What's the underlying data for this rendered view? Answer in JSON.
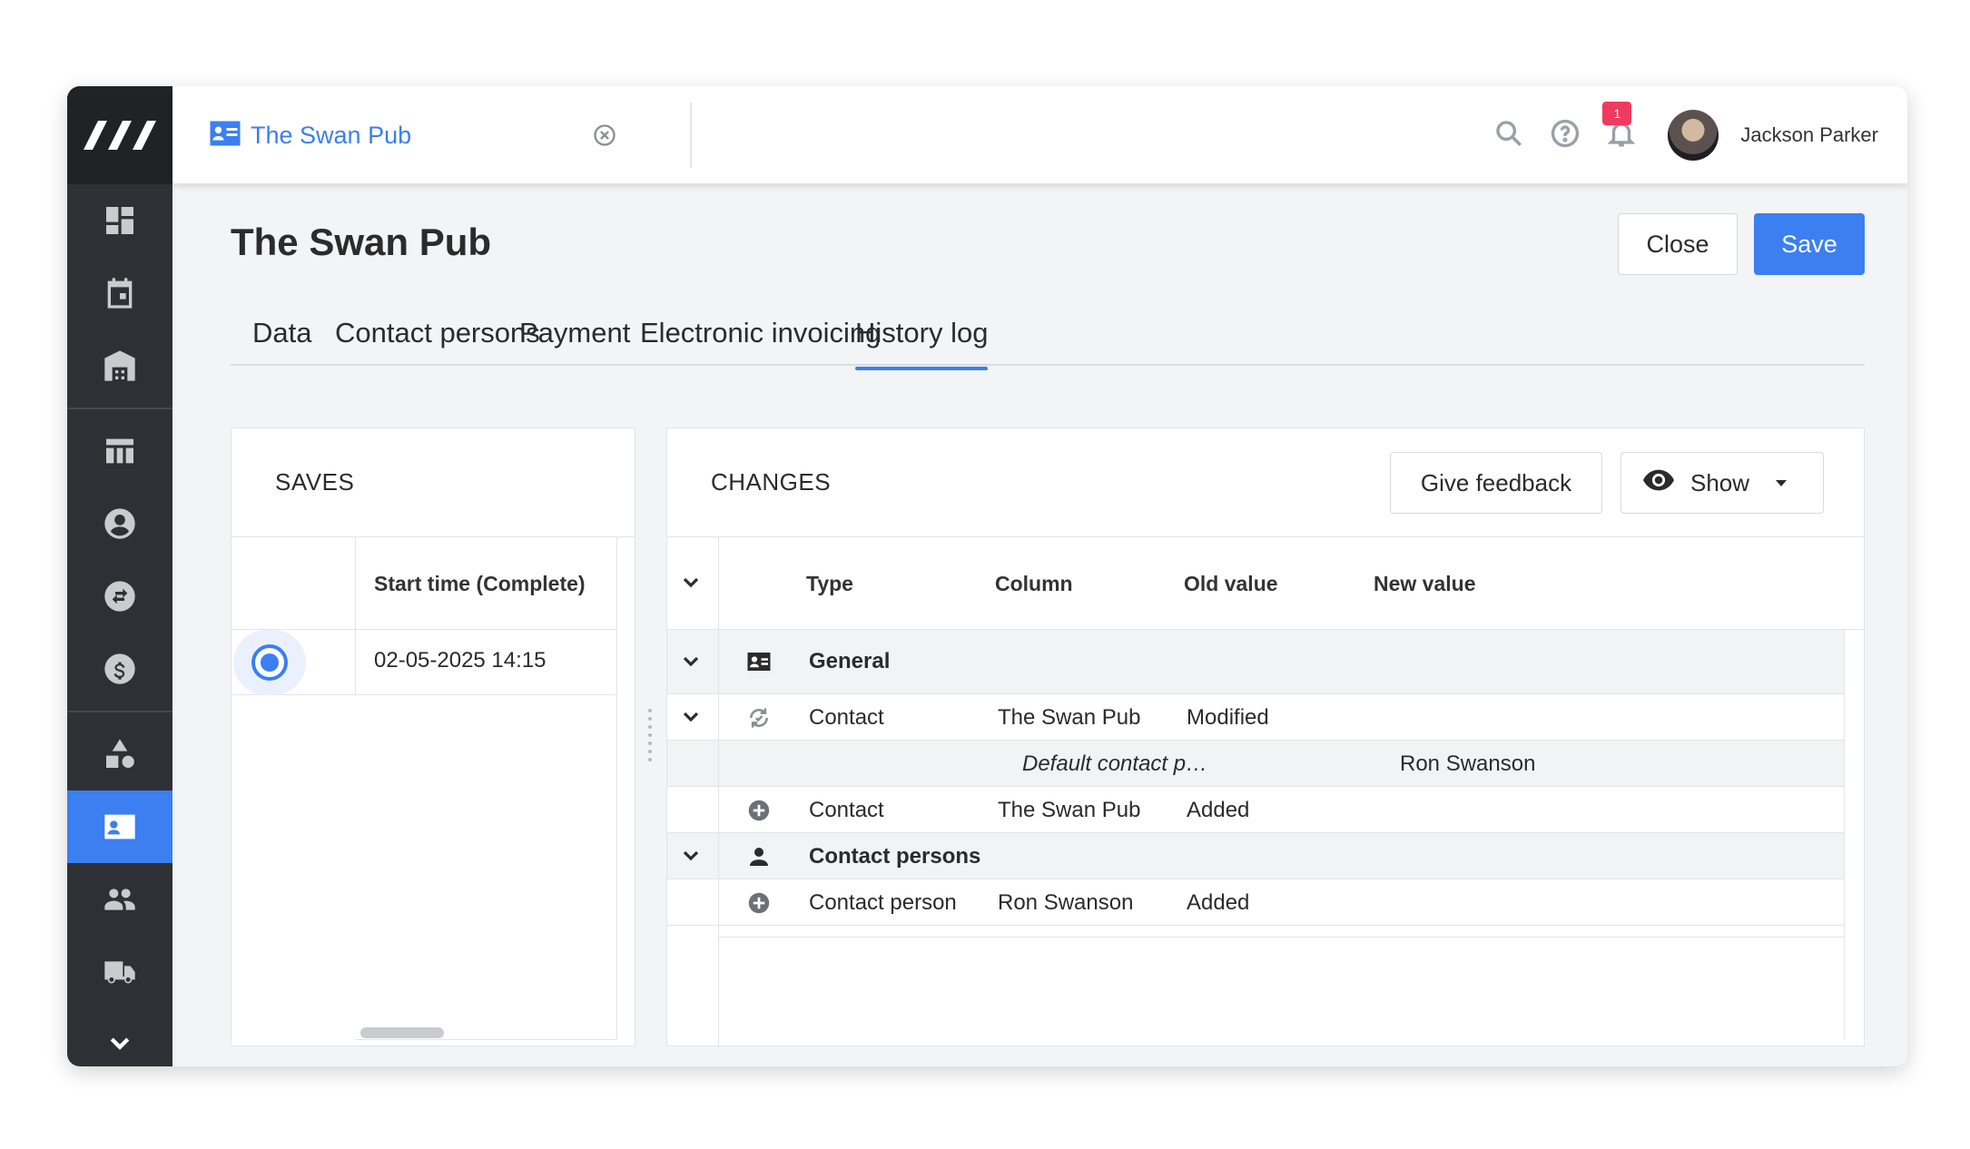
{
  "app": {
    "user": {
      "name": "Jackson Parker"
    },
    "notifications": {
      "count": "1"
    }
  },
  "document_tab": {
    "title": "The Swan Pub"
  },
  "page": {
    "title": "The Swan Pub",
    "close_label": "Close",
    "save_label": "Save"
  },
  "tabs": [
    {
      "label": "Data"
    },
    {
      "label": "Contact persons"
    },
    {
      "label": "Payment"
    },
    {
      "label": "Electronic invoicing"
    },
    {
      "label": "History log",
      "active": true
    }
  ],
  "saves": {
    "title": "SAVES",
    "column_header": "Start time (Complete)",
    "rows": [
      {
        "start_time": "02-05-2025 14:15",
        "selected": true
      }
    ]
  },
  "changes": {
    "title": "CHANGES",
    "give_feedback_label": "Give feedback",
    "show_label": "Show",
    "columns": {
      "type": "Type",
      "column": "Column",
      "old_value": "Old value",
      "new_value": "New value"
    },
    "rows": [
      {
        "kind": "group",
        "icon": "contact-card-icon",
        "type": "General"
      },
      {
        "kind": "entry",
        "icon": "refresh-icon",
        "type": "Contact",
        "column": "The Swan Pub",
        "old_value": "Modified"
      },
      {
        "kind": "detail",
        "column": "Default contact p…",
        "new_value": "Ron Swanson"
      },
      {
        "kind": "entry",
        "icon": "add-circle-icon",
        "type": "Contact",
        "column": "The Swan Pub",
        "old_value": "Added"
      },
      {
        "kind": "group",
        "icon": "person-icon",
        "type": "Contact persons"
      },
      {
        "kind": "entry",
        "icon": "add-circle-icon",
        "type": "Contact person",
        "column": "Ron Swanson",
        "old_value": "Added"
      }
    ]
  },
  "colors": {
    "accent": "#3b7ff0",
    "sidebar": "#2e3035",
    "badge": "#f03a5f"
  }
}
